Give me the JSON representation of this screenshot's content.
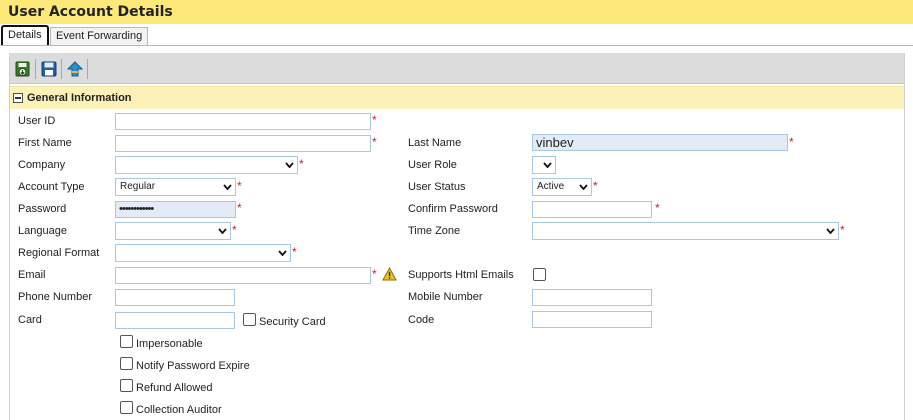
{
  "window": {
    "title": "User Account Details"
  },
  "tabs": [
    {
      "label": "Details",
      "active": true
    },
    {
      "label": "Event Forwarding",
      "active": false
    }
  ],
  "toolbar": {
    "icons": [
      "save-and-close-icon",
      "save-icon",
      "go-back-icon"
    ]
  },
  "section": {
    "title": "General Information",
    "icon": "collapse-minus-icon"
  },
  "form": {
    "user_id": {
      "label": "User ID",
      "value": "",
      "required": true
    },
    "first_name": {
      "label": "First Name",
      "value": "",
      "required": true
    },
    "last_name": {
      "label": "Last Name",
      "value": "vinbev",
      "required": true
    },
    "company": {
      "label": "Company",
      "value": "",
      "required": true
    },
    "user_role": {
      "label": "User Role",
      "value": ""
    },
    "account_type": {
      "label": "Account Type",
      "value": "Regular",
      "required": true
    },
    "user_status": {
      "label": "User Status",
      "value": "Active",
      "required": true
    },
    "password": {
      "label": "Password",
      "value": "••••••••••••",
      "required": true
    },
    "confirm_password": {
      "label": "Confirm Password",
      "value": "",
      "required": true
    },
    "language": {
      "label": "Language",
      "value": "",
      "required": true
    },
    "time_zone": {
      "label": "Time Zone",
      "value": "",
      "required": true
    },
    "regional_format": {
      "label": "Regional Format",
      "value": "",
      "required": true
    },
    "email": {
      "label": "Email",
      "value": "",
      "required": true,
      "warning_icon": "warning-triangle-icon"
    },
    "supports_html_emails": {
      "label": "Supports Html Emails",
      "checked": false
    },
    "phone_number": {
      "label": "Phone Number",
      "value": ""
    },
    "mobile_number": {
      "label": "Mobile Number",
      "value": ""
    },
    "card": {
      "label": "Card",
      "value": ""
    },
    "security_card": {
      "label": "Security Card",
      "checked": false
    },
    "code": {
      "label": "Code",
      "value": ""
    },
    "impersonable": {
      "label": "Impersonable",
      "checked": false
    },
    "notify_password_expire": {
      "label": "Notify Password Expire",
      "checked": false
    },
    "refund_allowed": {
      "label": "Refund Allowed",
      "checked": false
    },
    "collection_auditor": {
      "label": "Collection Auditor",
      "checked": false
    }
  },
  "colors": {
    "title_bar": "#fde97a",
    "section_header": "#fdf1b7",
    "input_border": "#a9c8e6",
    "required_marker": "#d21f1f"
  }
}
